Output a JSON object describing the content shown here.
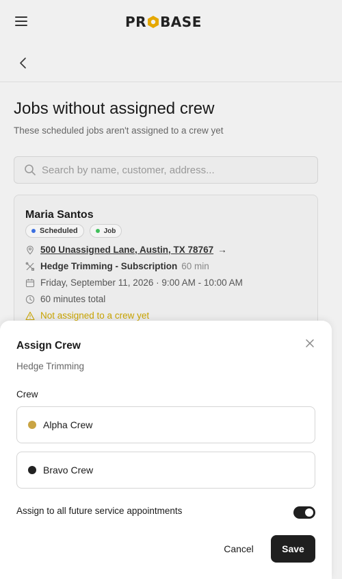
{
  "app": {
    "logo_left": "PR",
    "logo_right": "BASE",
    "logo_hex_color": "#e5a800"
  },
  "page": {
    "title": "Jobs without assigned crew",
    "subtitle": "These scheduled jobs aren't assigned to a crew yet"
  },
  "search": {
    "placeholder": "Search by name, customer, address..."
  },
  "job_card": {
    "customer_name": "Maria Santos",
    "status_badge": "Scheduled",
    "status_color": "#3b6fe0",
    "type_badge": "Job",
    "type_color": "#3fbf5a",
    "address": "500 Unassigned Lane, Austin, TX 78767",
    "address_arrow": "→",
    "service": "Hedge Trimming - Subscription",
    "service_duration": "60 min",
    "schedule": "Friday, September 11, 2026 · 9:00 AM - 10:00 AM",
    "total_duration": "60 minutes total",
    "warning": "Not assigned to a crew yet",
    "warning_color": "#c9a400"
  },
  "assign_sheet": {
    "title": "Assign Crew",
    "subtitle": "Hedge Trimming",
    "crew_label": "Crew",
    "crews": [
      {
        "name": "Alpha Crew",
        "color": "#c9a443"
      },
      {
        "name": "Bravo Crew",
        "color": "#222222"
      }
    ],
    "future_label": "Assign to all future service appointments",
    "future_enabled": true,
    "cancel_label": "Cancel",
    "save_label": "Save"
  }
}
